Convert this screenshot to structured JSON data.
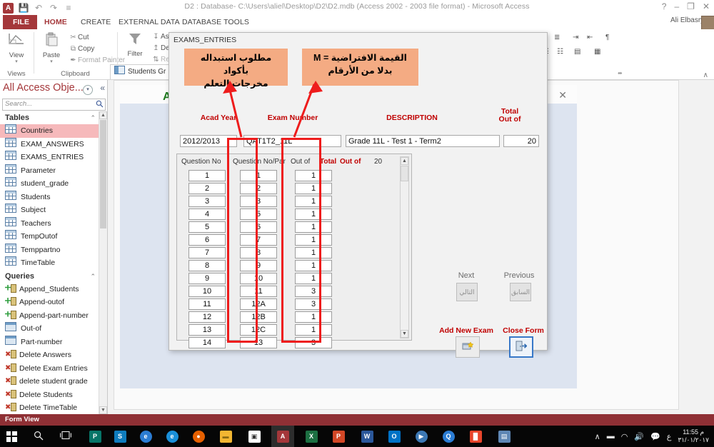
{
  "window": {
    "title": "D2 : Database- C:\\Users\\aliel\\Desktop\\D2\\D2.mdb (Access 2002 - 2003 file format) - Microsoft Access",
    "help_icon": "?",
    "minimize_icon": "–",
    "restore_icon": "❐",
    "close_icon": "✕",
    "app_logo_text": "A",
    "quick_access": [
      {
        "name": "save-icon",
        "glyph": "💾"
      },
      {
        "name": "undo-icon",
        "glyph": "↶"
      },
      {
        "name": "redo-icon",
        "glyph": "↷"
      },
      {
        "name": "customize-qat-icon",
        "glyph": "≡"
      }
    ],
    "user_name": "Ali Elbasry",
    "user_dropdown": "▾"
  },
  "tabs": [
    {
      "label": "FILE",
      "active": false,
      "file": true
    },
    {
      "label": "HOME",
      "active": true,
      "file": false
    },
    {
      "label": "CREATE",
      "active": false,
      "file": false
    },
    {
      "label": "EXTERNAL DATA",
      "active": false,
      "file": false
    },
    {
      "label": "DATABASE TOOLS",
      "active": false,
      "file": false
    }
  ],
  "ribbon": {
    "groups": [
      {
        "name": "Views"
      },
      {
        "name": "Clipboard"
      }
    ],
    "view_button": {
      "label": "View",
      "glyph": "◥",
      "arrow": "▾"
    },
    "paste_button": {
      "label": "Paste",
      "glyph": "⎘",
      "arrow": "▾"
    },
    "clipboard_items": [
      {
        "label": "Cut",
        "glyph": "✂"
      },
      {
        "label": "Copy",
        "glyph": "⧉"
      },
      {
        "label": "Format Painter",
        "glyph": "✒"
      }
    ],
    "sort_filter_items": [
      {
        "label": "Asce",
        "glyph": "↧"
      },
      {
        "label": "Desc",
        "glyph": "↥"
      },
      {
        "label": "Rem",
        "glyph": "⇅"
      }
    ],
    "filter_button": {
      "label": "Filter",
      "glyph": "▼"
    },
    "text_format_items": [
      {
        "glyph": "≡"
      },
      {
        "glyph": "≣"
      },
      {
        "glyph": "⇥"
      },
      {
        "glyph": "⇤"
      },
      {
        "glyph": "¶"
      },
      {
        "glyph": "☰"
      },
      {
        "glyph": "☷"
      },
      {
        "glyph": "▤"
      },
      {
        "glyph": "▦"
      }
    ],
    "dialog_launcher": "⬌",
    "collapse_ribbon": "∧"
  },
  "nav_pane": {
    "title": "All Access Obje...",
    "dropdown_icon": "▾",
    "collapse_icon": "«",
    "search_placeholder": "Search...",
    "search_icon": "🔍",
    "groups": [
      {
        "name": "Tables",
        "collapse": "⌃",
        "items": [
          {
            "label": "Countries",
            "icon": "table-icon",
            "selected": true
          },
          {
            "label": "EXAM_ANSWERS",
            "icon": "table-icon",
            "selected": false
          },
          {
            "label": "EXAMS_ENTRIES",
            "icon": "table-icon",
            "selected": false
          },
          {
            "label": "Parameter",
            "icon": "table-icon",
            "selected": false
          },
          {
            "label": "student_grade",
            "icon": "table-icon",
            "selected": false
          },
          {
            "label": "Students",
            "icon": "table-icon",
            "selected": false
          },
          {
            "label": "Subject",
            "icon": "table-icon",
            "selected": false
          },
          {
            "label": "Teachers",
            "icon": "table-icon",
            "selected": false
          },
          {
            "label": "TempOutof",
            "icon": "table-icon",
            "selected": false
          },
          {
            "label": "Temppartno",
            "icon": "table-icon",
            "selected": false
          },
          {
            "label": "TimeTable",
            "icon": "table-icon",
            "selected": false
          }
        ]
      },
      {
        "name": "Queries",
        "collapse": "⌃",
        "items": [
          {
            "label": "Append_Students",
            "icon": "append-query-icon",
            "selected": false
          },
          {
            "label": "Append-outof",
            "icon": "append-query-icon",
            "selected": false
          },
          {
            "label": "Append-part-number",
            "icon": "append-query-icon",
            "selected": false
          },
          {
            "label": "Out-of",
            "icon": "select-query-icon",
            "selected": false
          },
          {
            "label": "Part-number",
            "icon": "select-query-icon",
            "selected": false
          },
          {
            "label": "Delete Answers",
            "icon": "delete-query-icon",
            "selected": false
          },
          {
            "label": "Delete Exam Entries",
            "icon": "delete-query-icon",
            "selected": false
          },
          {
            "label": "delete student grade",
            "icon": "delete-query-icon",
            "selected": false
          },
          {
            "label": "Delete Students",
            "icon": "delete-query-icon",
            "selected": false
          },
          {
            "label": "Delete TimeTable",
            "icon": "delete-query-icon",
            "selected": false
          }
        ]
      }
    ],
    "scroll_up": "▲",
    "scroll_down": "▼"
  },
  "document_tab": {
    "label": "Students Gr",
    "icon": "form-icon"
  },
  "background_form": {
    "title": "A",
    "close_icon": "✕"
  },
  "dialog": {
    "title": "EXAMS_ENTRIES",
    "headers": {
      "acad_year": "Acad Year",
      "exam_number": "Exam Number",
      "description": "DESCRIPTION",
      "total_out_of_line1": "Total",
      "total_out_of_line2": "Out of"
    },
    "record": {
      "acad_year": "2012/2013",
      "exam_number": "QAT1T2_11L",
      "description": "Grade 11L - Test 1 - Term2",
      "total_out_of": "20"
    },
    "grid": {
      "columns": [
        {
          "label": "Question No",
          "red": false
        },
        {
          "label": "Question No/Par",
          "red": false
        },
        {
          "label": "Out of",
          "red": false
        },
        {
          "label": "Total",
          "red": true
        },
        {
          "label": "Out of",
          "red": true
        }
      ],
      "total_value": "20",
      "rows": [
        {
          "question_no": "1",
          "question_no_part": "1",
          "out_of": "1"
        },
        {
          "question_no": "2",
          "question_no_part": "2",
          "out_of": "1"
        },
        {
          "question_no": "3",
          "question_no_part": "3",
          "out_of": "1"
        },
        {
          "question_no": "4",
          "question_no_part": "5",
          "out_of": "1"
        },
        {
          "question_no": "5",
          "question_no_part": "6",
          "out_of": "1"
        },
        {
          "question_no": "6",
          "question_no_part": "7",
          "out_of": "1"
        },
        {
          "question_no": "7",
          "question_no_part": "8",
          "out_of": "1"
        },
        {
          "question_no": "8",
          "question_no_part": "9",
          "out_of": "1"
        },
        {
          "question_no": "9",
          "question_no_part": "10",
          "out_of": "1"
        },
        {
          "question_no": "10",
          "question_no_part": "11",
          "out_of": "3"
        },
        {
          "question_no": "11",
          "question_no_part": "12A",
          "out_of": "3"
        },
        {
          "question_no": "12",
          "question_no_part": "12B",
          "out_of": "1"
        },
        {
          "question_no": "13",
          "question_no_part": "12C",
          "out_of": "1"
        },
        {
          "question_no": "14",
          "question_no_part": "13",
          "out_of": "3"
        }
      ],
      "scroll_up": "▲",
      "scroll_down": "▼"
    },
    "buttons": {
      "next_label": "Next",
      "next_arabic": "التالي",
      "previous_label": "Previous",
      "previous_arabic": "السابق",
      "add_new_exam_label": "Add New Exam",
      "add_new_exam_icon": "🗂",
      "close_form_label": "Close Form",
      "close_form_icon": "🚪"
    }
  },
  "annotations": [
    {
      "id": "anno-replace-codes",
      "line1": "مطلوب استبداله بأكواد",
      "line2": "مخرجات التعلم"
    },
    {
      "id": "anno-default-value",
      "line1": "القيمة الافتراضية = M",
      "line2": "بدلا من الأرقام"
    }
  ],
  "colors": {
    "accent_red": "#a4373a",
    "label_red": "#c00000",
    "annotation_bg": "#f4ab83",
    "annotation_arrow": "#ee1c1c",
    "selection_pink": "#f6b9bb",
    "status_bar": "#8f3035"
  },
  "status_bar": {
    "text": "Form View"
  },
  "taskbar": {
    "start_icon": "windows-logo",
    "search_icon": "🔍",
    "task_view_icon": "❑",
    "items": [
      {
        "name": "publisher",
        "letter": "P",
        "color": "#077568"
      },
      {
        "name": "sway",
        "letter": "S",
        "color": "#0f7cbd"
      },
      {
        "name": "edge",
        "letter": "e",
        "color": "#2b7cd3"
      },
      {
        "name": "internet-explorer",
        "letter": "e",
        "color": "#1a8fd8"
      },
      {
        "name": "firefox",
        "letter": "●",
        "color": "#e66000"
      },
      {
        "name": "file-explorer",
        "letter": "▬",
        "color": "#f2b632"
      },
      {
        "name": "store",
        "letter": "▣",
        "color": "#ffffff"
      },
      {
        "name": "access",
        "letter": "A",
        "color": "#a4373a",
        "active": true
      },
      {
        "name": "excel",
        "letter": "X",
        "color": "#1d6f42"
      },
      {
        "name": "powerpoint",
        "letter": "P",
        "color": "#d24726"
      },
      {
        "name": "word",
        "letter": "W",
        "color": "#2b579a"
      },
      {
        "name": "outlook",
        "letter": "O",
        "color": "#0072c6"
      },
      {
        "name": "media-player",
        "letter": "▶",
        "color": "#3c78b4"
      },
      {
        "name": "qbittorrent",
        "letter": "Q",
        "color": "#2b7cd3"
      },
      {
        "name": "pdf-reader",
        "letter": "█",
        "color": "#e8452b"
      },
      {
        "name": "remote-desktop",
        "letter": "▤",
        "color": "#5f87b5"
      }
    ],
    "tray": [
      {
        "name": "show-hidden-icons",
        "glyph": "∧"
      },
      {
        "name": "battery-icon",
        "glyph": "▬"
      },
      {
        "name": "wifi-icon",
        "glyph": "◠"
      },
      {
        "name": "volume-icon",
        "glyph": "🔊"
      },
      {
        "name": "action-center-icon",
        "glyph": "💬"
      },
      {
        "name": "language-indicator",
        "glyph": "ع"
      }
    ],
    "clock_time": "11:55 م",
    "clock_date": "٣١/٠١/٢٠١٧"
  }
}
